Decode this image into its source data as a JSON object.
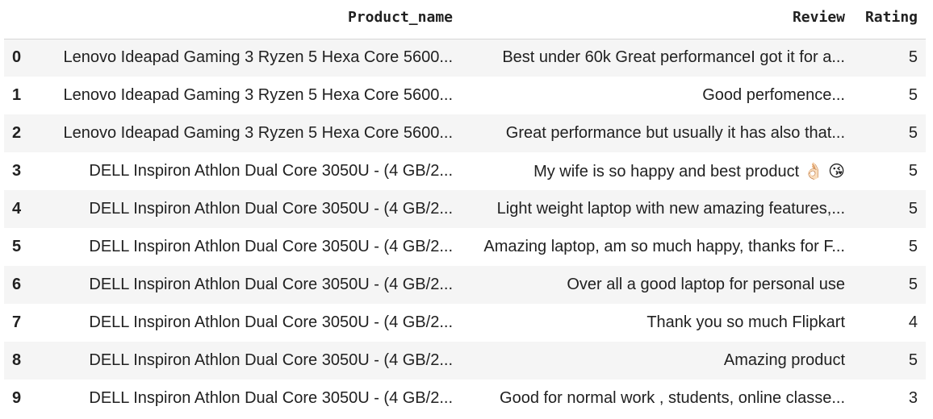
{
  "table": {
    "columns": [
      "Product_name",
      "Review",
      "Rating"
    ],
    "rows": [
      {
        "index": "0",
        "product_name": "Lenovo Ideapad Gaming 3 Ryzen 5 Hexa Core 5600...",
        "review": "Best under 60k Great performanceI got it for a...",
        "rating": "5"
      },
      {
        "index": "1",
        "product_name": "Lenovo Ideapad Gaming 3 Ryzen 5 Hexa Core 5600...",
        "review": "Good perfomence...",
        "rating": "5"
      },
      {
        "index": "2",
        "product_name": "Lenovo Ideapad Gaming 3 Ryzen 5 Hexa Core 5600...",
        "review": "Great performance but usually it has also that...",
        "rating": "5"
      },
      {
        "index": "3",
        "product_name": "DELL Inspiron Athlon Dual Core 3050U - (4 GB/2...",
        "review": "My wife is so happy and best product 👌🏻 😘",
        "rating": "5"
      },
      {
        "index": "4",
        "product_name": "DELL Inspiron Athlon Dual Core 3050U - (4 GB/2...",
        "review": "Light weight laptop with new amazing features,...",
        "rating": "5"
      },
      {
        "index": "5",
        "product_name": "DELL Inspiron Athlon Dual Core 3050U - (4 GB/2...",
        "review": "Amazing laptop, am so much happy, thanks for F...",
        "rating": "5"
      },
      {
        "index": "6",
        "product_name": "DELL Inspiron Athlon Dual Core 3050U - (4 GB/2...",
        "review": "Over all a good laptop for personal use",
        "rating": "5"
      },
      {
        "index": "7",
        "product_name": "DELL Inspiron Athlon Dual Core 3050U - (4 GB/2...",
        "review": "Thank you so much Flipkart",
        "rating": "4"
      },
      {
        "index": "8",
        "product_name": "DELL Inspiron Athlon Dual Core 3050U - (4 GB/2...",
        "review": "Amazing product",
        "rating": "5"
      },
      {
        "index": "9",
        "product_name": "DELL Inspiron Athlon Dual Core 3050U - (4 GB/2...",
        "review": "Good for normal work , students, online classe...",
        "rating": "3"
      }
    ]
  }
}
